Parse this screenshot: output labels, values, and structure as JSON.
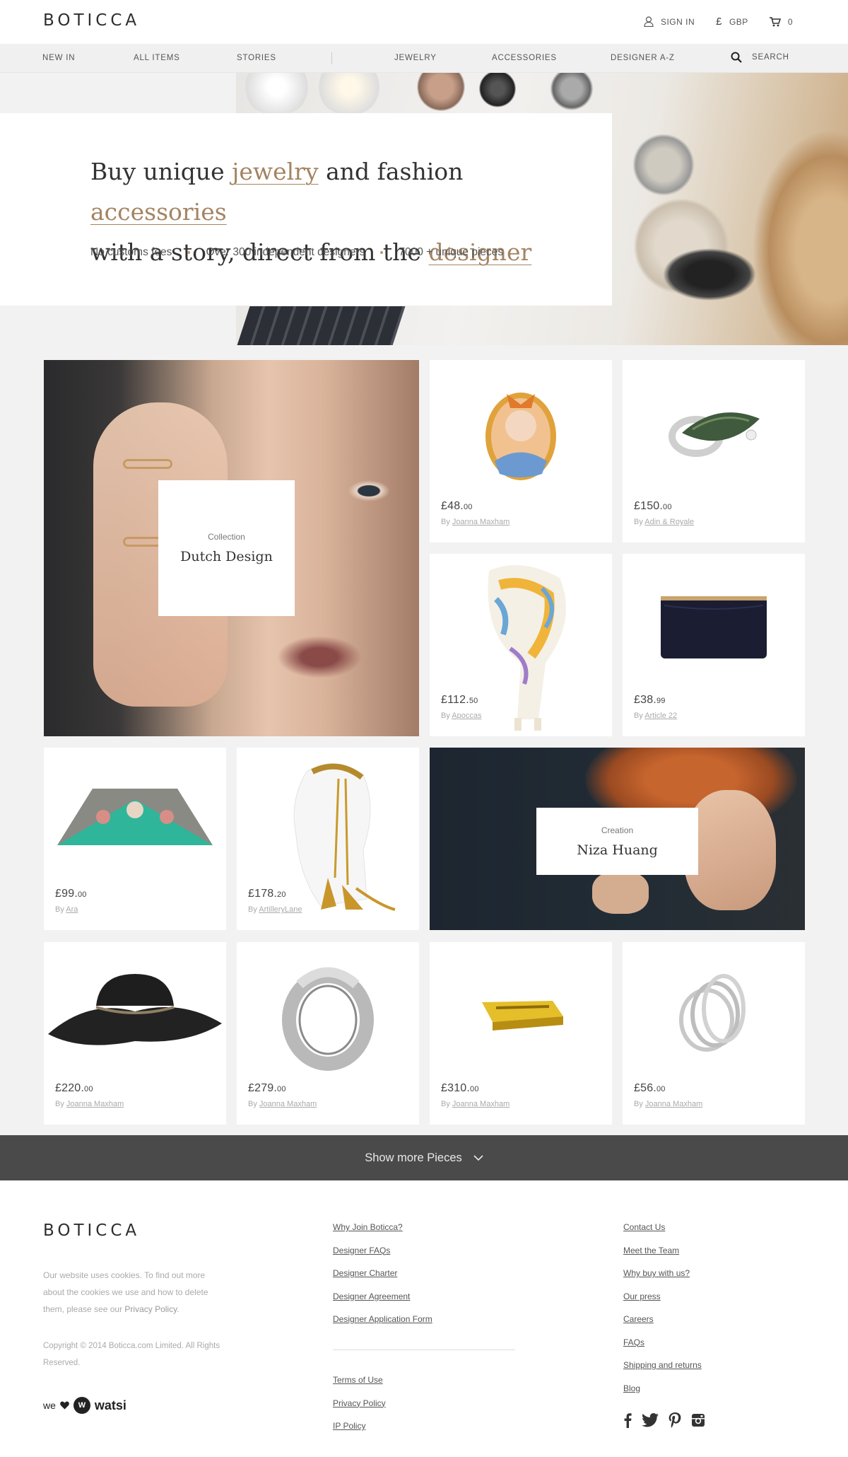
{
  "header": {
    "logo": "BOTICCA",
    "sign_in": "SIGN IN",
    "currency_symbol": "£",
    "currency": "GBP",
    "cart_count": "0"
  },
  "nav": {
    "items": [
      "NEW IN",
      "ALL ITEMS",
      "STORIES",
      "JEWELRY",
      "ACCESSORIES",
      "DESIGNER A-Z"
    ],
    "search": "SEARCH"
  },
  "hero": {
    "line1_a": "Buy unique ",
    "line1_link1": "jewelry",
    "line1_b": " and fashion ",
    "line1_link2": "accessories",
    "line2_a": "with a story, direct from the ",
    "line2_link": "designer",
    "usps": [
      "No customs fees",
      "Over 300 independent designers",
      "7000 + unique pieces"
    ]
  },
  "features": {
    "collection": {
      "kicker": "Collection",
      "title": "Dutch Design"
    },
    "creation": {
      "kicker": "Creation",
      "title": "Niza Huang"
    }
  },
  "products": [
    {
      "price_main": "£48.",
      "price_cents": "00",
      "by": "By ",
      "designer": "Joanna Maxham",
      "icon": "portrait-brooch"
    },
    {
      "price_main": "£150.",
      "price_cents": "00",
      "by": "By ",
      "designer": "Adin & Royale",
      "icon": "stone-ring"
    },
    {
      "price_main": "£112.",
      "price_cents": "50",
      "by": "By ",
      "designer": "Apoccas",
      "icon": "printed-scarf"
    },
    {
      "price_main": "£38.",
      "price_cents": "99",
      "by": "By ",
      "designer": "Article 22",
      "icon": "navy-pouch"
    },
    {
      "price_main": "£99.",
      "price_cents": "00",
      "by": "By ",
      "designer": "Ara",
      "icon": "triangle-clutch"
    },
    {
      "price_main": "£178.",
      "price_cents": "20",
      "by": "By ",
      "designer": "ArtilleryLane",
      "icon": "headband"
    },
    {
      "price_main": "£220.",
      "price_cents": "00",
      "by": "By ",
      "designer": "Joanna Maxham",
      "icon": "black-hat"
    },
    {
      "price_main": "£279.",
      "price_cents": "00",
      "by": "By ",
      "designer": "Joanna Maxham",
      "icon": "silver-ring"
    },
    {
      "price_main": "£310.",
      "price_cents": "00",
      "by": "By ",
      "designer": "Joanna Maxham",
      "icon": "gold-ring"
    },
    {
      "price_main": "£56.",
      "price_cents": "00",
      "by": "By ",
      "designer": "Joanna Maxham",
      "icon": "wire-ring"
    }
  ],
  "show_more": "Show more Pieces",
  "footer": {
    "logo": "BOTICCA",
    "cookie_text": "Our website uses cookies. To find out more about the cookies we use and how to delete them, please see our ",
    "cookie_link": "Privacy Policy",
    "cookie_end": ".",
    "copyright": "Copyright © 2014 Boticca.com Limited. All Rights Reserved.",
    "watsi_we": "we",
    "watsi_name": "watsi",
    "col2": [
      "Why Join Boticca?",
      "Designer FAQs",
      "Designer Charter",
      "Designer Agreement",
      "Designer Application Form"
    ],
    "col2_legal": [
      "Terms of Use",
      "Privacy Policy",
      "IP Policy"
    ],
    "col3": [
      "Contact Us",
      "Meet the Team",
      "Why buy with us?",
      "Our press",
      "Careers",
      "FAQs",
      "Shipping and returns",
      "Blog"
    ],
    "social": [
      "facebook-icon",
      "twitter-icon",
      "pinterest-icon",
      "instagram-icon"
    ]
  },
  "colors": {
    "accent": "#a48462",
    "bar": "#4a4a4a",
    "page_bg": "#f2f2f2"
  }
}
